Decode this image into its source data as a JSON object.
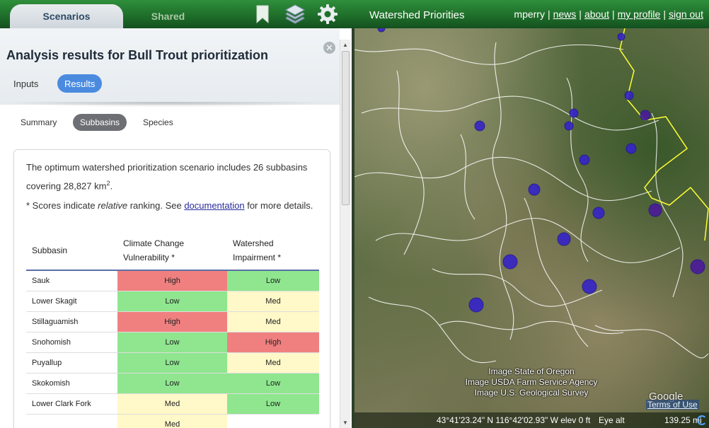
{
  "topbar": {
    "tabs": [
      {
        "label": "Scenarios",
        "active": true
      },
      {
        "label": "Shared",
        "active": false
      }
    ],
    "icons": [
      "bookmark-icon",
      "layers-icon",
      "gear-icon"
    ],
    "app_title": "Watershed Priorities",
    "user": "mperry",
    "links": [
      "news",
      "about",
      "my profile",
      "sign out"
    ],
    "colors": {
      "bar": "#1f6f2a",
      "accent": "#4a8be0"
    }
  },
  "panel": {
    "title": "Analysis results for Bull Trout prioritization",
    "tabs": [
      {
        "label": "Inputs",
        "active": false
      },
      {
        "label": "Results",
        "active": true
      }
    ],
    "subtabs": [
      {
        "label": "Summary",
        "active": false
      },
      {
        "label": "Subbasins",
        "active": true
      },
      {
        "label": "Species",
        "active": false
      }
    ],
    "intro_before": "The optimum watershed prioritization scenario includes 26 subbasins covering 28,827 km",
    "intro_sup": "2",
    "intro_after": ".",
    "note_before": "* Scores indicate ",
    "note_em": "relative",
    "note_mid": " ranking. See ",
    "note_link": "documentation",
    "note_after": " for more details.",
    "table": {
      "headers": [
        "Subbasin",
        "Climate Change Vulnerability *",
        "Watershed Impairment *"
      ],
      "rows": [
        {
          "subbasin": "Sauk",
          "climate": "High",
          "impairment": "Low"
        },
        {
          "subbasin": "Lower Skagit",
          "climate": "Low",
          "impairment": "Med"
        },
        {
          "subbasin": "Stillaguamish",
          "climate": "High",
          "impairment": "Med"
        },
        {
          "subbasin": "Snohomish",
          "climate": "Low",
          "impairment": "High"
        },
        {
          "subbasin": "Puyallup",
          "climate": "Low",
          "impairment": "Med"
        },
        {
          "subbasin": "Skokomish",
          "climate": "Low",
          "impairment": "Low"
        },
        {
          "subbasin": "Lower Clark Fork",
          "climate": "Med",
          "impairment": "Low"
        },
        {
          "subbasin": "",
          "climate": "Med",
          "impairment": ""
        }
      ],
      "rating_colors": {
        "High": "#f08080",
        "Med": "#fff8c8",
        "Low": "#8fe68f"
      }
    }
  },
  "map": {
    "attributions": [
      "Image State of Oregon",
      "Image USDA Farm Service Agency",
      "Image U.S. Geological Survey"
    ],
    "logo": "Google",
    "terms": "Terms of Use",
    "coordinates": "43°41'23.24\" N 116°42'02.93\" W elev   0 ft",
    "eye_alt_label": "Eye alt",
    "eye_alt_value": "139.25 mi"
  }
}
